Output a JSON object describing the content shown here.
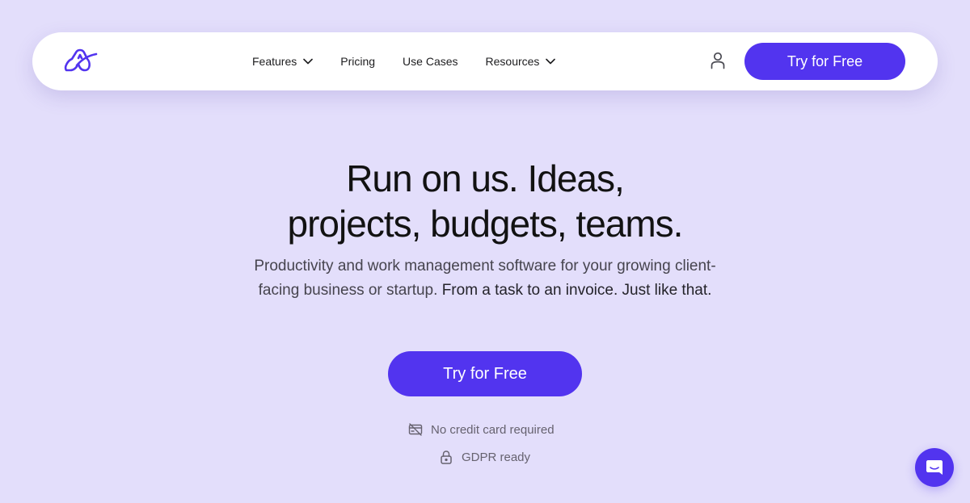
{
  "nav": {
    "logo": "brand-logo",
    "items": [
      {
        "label": "Features",
        "has_dropdown": true
      },
      {
        "label": "Pricing",
        "has_dropdown": false
      },
      {
        "label": "Use Cases",
        "has_dropdown": false
      },
      {
        "label": "Resources",
        "has_dropdown": true
      }
    ],
    "account_icon": "user-icon",
    "cta_label": "Try for Free"
  },
  "hero": {
    "title_line1": "Run on us. Ideas,",
    "title_line2": "projects, budgets, teams.",
    "subtitle_light": "Productivity and work management software for your growing client-facing business or startup.",
    "subtitle_strong": "From a task to an invoice. Just like that.",
    "cta_label": "Try for Free",
    "perks": [
      {
        "icon": "no-credit-card-icon",
        "label": "No credit card required"
      },
      {
        "icon": "lock-icon",
        "label": "GDPR ready"
      }
    ]
  },
  "chat_widget": {
    "icon": "chat-icon"
  },
  "colors": {
    "accent": "#5234ef",
    "background": "#e3defb",
    "nav_background": "#ffffff"
  }
}
